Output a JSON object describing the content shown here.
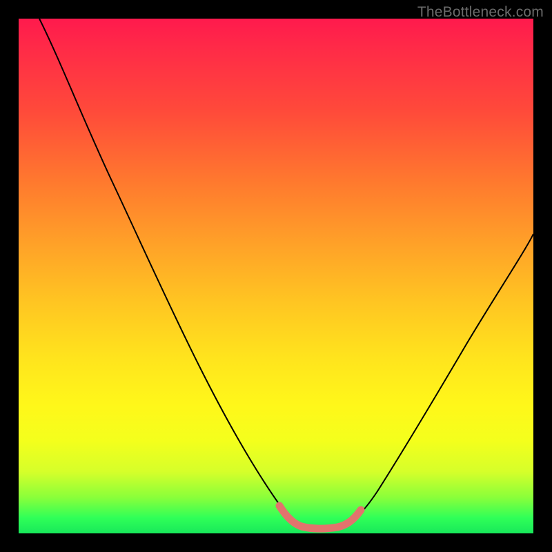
{
  "watermark": "TheBottleneck.com",
  "chart_data": {
    "type": "line",
    "title": "",
    "xlabel": "",
    "ylabel": "",
    "xlim": [
      0,
      100
    ],
    "ylim": [
      0,
      100
    ],
    "grid": false,
    "legend": false,
    "series": [
      {
        "name": "main-curve",
        "color": "#000000",
        "x": [
          4,
          10,
          16,
          22,
          28,
          34,
          40,
          46,
          50,
          54,
          56,
          58,
          60,
          62,
          64,
          68,
          74,
          80,
          86,
          92,
          98,
          100
        ],
        "y": [
          100,
          88,
          76,
          64,
          52,
          40,
          28,
          16,
          8,
          3,
          2,
          1.5,
          1.5,
          2,
          3,
          7,
          16,
          26,
          36,
          46,
          56,
          60
        ]
      },
      {
        "name": "trough-highlight",
        "color": "#e2736d",
        "x": [
          50,
          52,
          54,
          56,
          58,
          60,
          62,
          64,
          66
        ],
        "y": [
          5,
          3,
          2,
          1.5,
          1.5,
          1.5,
          2,
          2.5,
          4
        ]
      }
    ],
    "background": {
      "type": "vertical-gradient",
      "stops": [
        {
          "pos": 0,
          "color": "#ff1a4d"
        },
        {
          "pos": 44,
          "color": "#ffa228"
        },
        {
          "pos": 75,
          "color": "#fff71a"
        },
        {
          "pos": 100,
          "color": "#18e85a"
        }
      ]
    }
  }
}
